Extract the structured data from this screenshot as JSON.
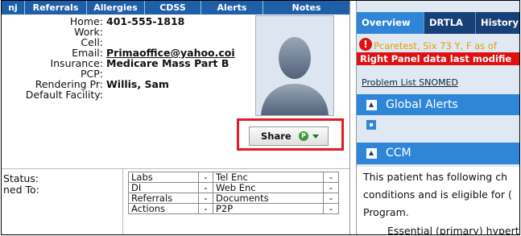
{
  "left_tabs": [
    "nj",
    "Referrals",
    "Allergies",
    "CDSS",
    "Alerts",
    "Notes"
  ],
  "patient": {
    "home_label": "Home:",
    "home_value": "401-555-1818",
    "work_label": "Work:",
    "cell_label": "Cell:",
    "email_label": "Email:",
    "email_value": "Primaoffice@yahoo.coi",
    "insurance_label": "Insurance:",
    "insurance_value": "Medicare Mass Part B",
    "pcp_label": "PCP:",
    "rendering_label": "Rendering Pr:",
    "rendering_value": "Willis, Sam",
    "facility_label": "Default Facility:"
  },
  "share": {
    "label": "Share",
    "badge": "P"
  },
  "status": {
    "status_label": "Status:",
    "assigned_label": "ned To:"
  },
  "links_table": [
    {
      "left": "Labs",
      "left_dash": "-",
      "right": "Tel Enc",
      "right_dash": "-"
    },
    {
      "left": "DI",
      "left_dash": "-",
      "right": "Web Enc",
      "right_dash": "-"
    },
    {
      "left": "Referrals",
      "left_dash": "-",
      "right": "Documents",
      "right_dash": "-"
    },
    {
      "left": "Actions",
      "left_dash": "-",
      "right": "P2P",
      "right_dash": "-"
    }
  ],
  "right_tabs": [
    "Overview",
    "DRTLA",
    "History"
  ],
  "right_panel": {
    "alert_icon": "!",
    "alert_text": "Pcaretest, Six 73 Y, F as of",
    "modified_text": "Right Panel data last modifie",
    "problem_link": "Problem List SNOMED",
    "global_alerts": "Global Alerts",
    "ccm_header": "CCM",
    "ccm_lines": [
      "This patient has following ch",
      "conditions and is eligible for (",
      "Program.",
      "Essential (primary) hypert"
    ]
  },
  "colors": {
    "tab_bar": "#1f5fa8",
    "right_tab_bar": "#173f78",
    "active_tab": "#2f86d8",
    "highlight_border": "#e31b23",
    "alert_red": "#e01010",
    "alert_text": "#e0a000",
    "right_bg": "#dfe8f3"
  },
  "icons": {
    "avatar": "person-silhouette",
    "share_badge": "green-circle-p",
    "share_caret": "caret-down",
    "alert": "exclamation-circle",
    "collapse": "triangle-up",
    "expand": "square"
  }
}
